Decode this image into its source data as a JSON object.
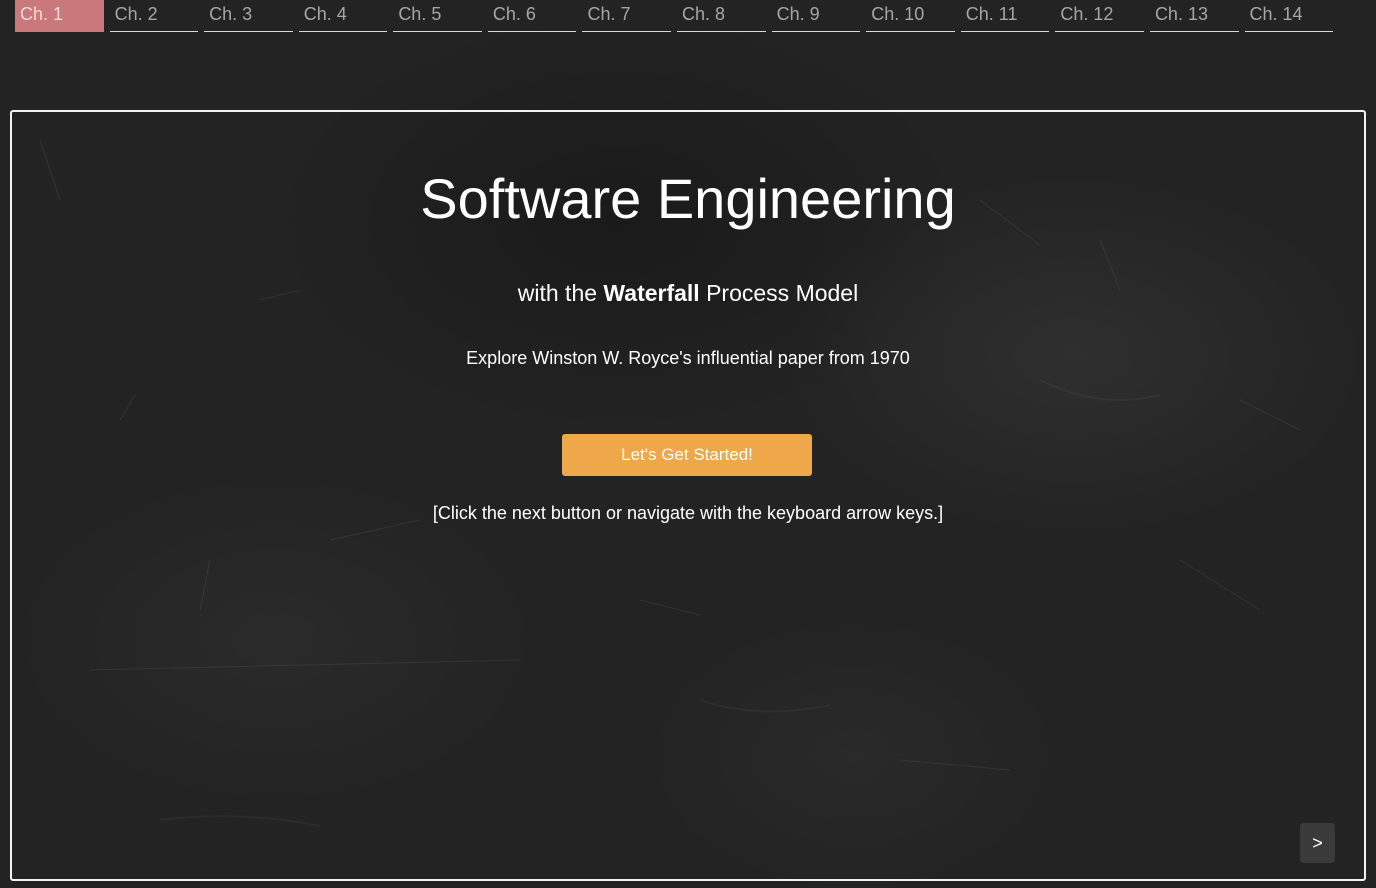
{
  "chapter_nav": {
    "tabs": [
      {
        "label": "Ch. 1",
        "active": true
      },
      {
        "label": "Ch. 2",
        "active": false
      },
      {
        "label": "Ch. 3",
        "active": false
      },
      {
        "label": "Ch. 4",
        "active": false
      },
      {
        "label": "Ch. 5",
        "active": false
      },
      {
        "label": "Ch. 6",
        "active": false
      },
      {
        "label": "Ch. 7",
        "active": false
      },
      {
        "label": "Ch. 8",
        "active": false
      },
      {
        "label": "Ch. 9",
        "active": false
      },
      {
        "label": "Ch. 10",
        "active": false
      },
      {
        "label": "Ch. 11",
        "active": false
      },
      {
        "label": "Ch. 12",
        "active": false
      },
      {
        "label": "Ch. 13",
        "active": false
      },
      {
        "label": "Ch. 14",
        "active": false
      }
    ]
  },
  "slide": {
    "title": "Software Engineering",
    "subtitle_prefix": "with the ",
    "subtitle_emphasis": "Waterfall",
    "subtitle_suffix": " Process Model",
    "intro": "Explore Winston W. Royce's influential paper from 1970",
    "start_button_label": "Let's Get Started!",
    "hint": "[Click the next button or navigate with the keyboard arrow keys.]",
    "next_button_label": ">"
  },
  "colors": {
    "background": "#232323",
    "active_tab": "#c9797c",
    "inactive_tab_text": "#a6a6a6",
    "start_button": "#eea84a",
    "next_button": "#3a3a3a",
    "panel_border": "#f2f2f2"
  },
  "icons": {
    "next": "chevron-right-icon"
  }
}
